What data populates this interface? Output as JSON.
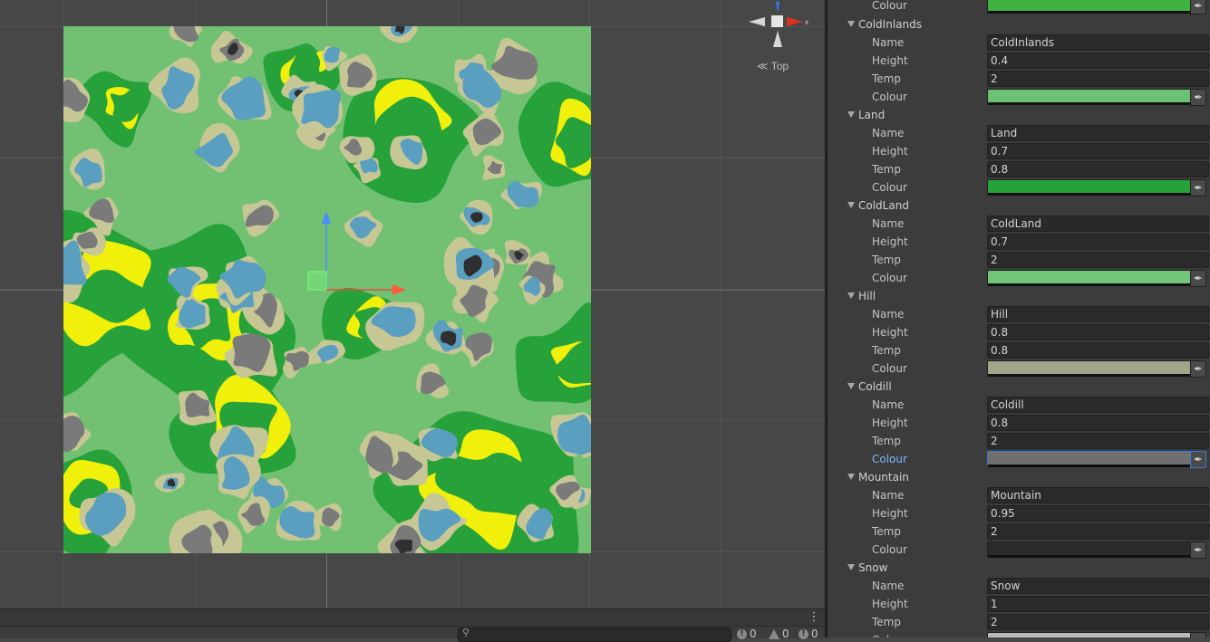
{
  "scene": {
    "view_label": "Top",
    "gizmo_axis_label": "x"
  },
  "colors": {
    "water": "#5a9fc0",
    "ground": "#72c173",
    "land": "#27a13a",
    "sand": "#f0f00a",
    "hill": "#a0a88a",
    "rock": "#7a7a7a",
    "mountain": "#2f2f2f",
    "beach": "#c7c796"
  },
  "inspector": {
    "top_colour_label": "Colour",
    "top_colour_value": "#3fb23f",
    "groups": [
      {
        "title": "ColdInlands",
        "name_label": "Name",
        "name": "ColdInlands",
        "height_label": "Height",
        "height": "0.4",
        "temp_label": "Temp",
        "temp": "2",
        "colour_label": "Colour",
        "colour": "#6ec174",
        "colour_active": false
      },
      {
        "title": "Land",
        "name_label": "Name",
        "name": "Land",
        "height_label": "Height",
        "height": "0.7",
        "temp_label": "Temp",
        "temp": "0.8",
        "colour_label": "Colour",
        "colour": "#27a13a",
        "colour_active": false
      },
      {
        "title": "ColdLand",
        "name_label": "Name",
        "name": "ColdLand",
        "height_label": "Height",
        "height": "0.7",
        "temp_label": "Temp",
        "temp": "2",
        "colour_label": "Colour",
        "colour": "#72c577",
        "colour_active": false
      },
      {
        "title": "Hill",
        "name_label": "Name",
        "name": "Hill",
        "height_label": "Height",
        "height": "0.8",
        "temp_label": "Temp",
        "temp": "0.8",
        "colour_label": "Colour",
        "colour": "#a1a68b",
        "colour_active": false
      },
      {
        "title": "Coldill",
        "name_label": "Name",
        "name": "Coldill",
        "height_label": "Height",
        "height": "0.8",
        "temp_label": "Temp",
        "temp": "2",
        "colour_label": "Colour",
        "colour": "#6f6f6f",
        "colour_active": true
      },
      {
        "title": "Mountain",
        "name_label": "Name",
        "name": "Mountain",
        "height_label": "Height",
        "height": "0.95",
        "temp_label": "Temp",
        "temp": "2",
        "colour_label": "Colour",
        "colour": "#2b2b2b",
        "colour_active": false
      },
      {
        "title": "Snow",
        "name_label": "Name",
        "name": "Snow",
        "height_label": "Height",
        "height": "1",
        "temp_label": "Temp",
        "temp": "2",
        "colour_label": "Colour",
        "colour": "#b9b9b9",
        "colour_active": false
      }
    ]
  },
  "console": {
    "log_count": "0",
    "warning_count": "0",
    "error_count": "0"
  }
}
